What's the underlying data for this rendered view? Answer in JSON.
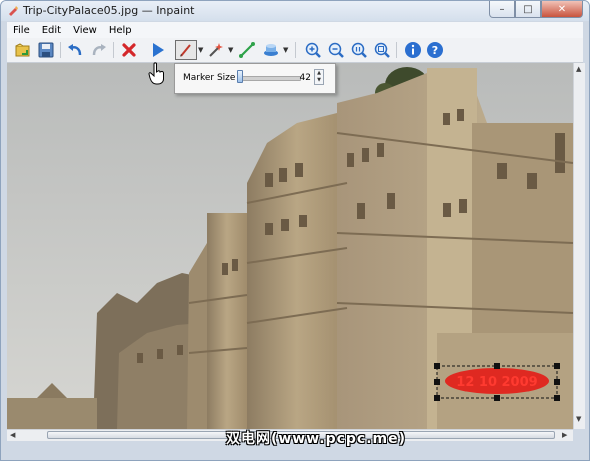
{
  "window": {
    "title": "Trip-CityPalace05.jpg — Inpaint"
  },
  "menu": [
    "File",
    "Edit",
    "View",
    "Help"
  ],
  "toolbar": {
    "icons": [
      "open-icon",
      "save-icon",
      "undo-icon",
      "redo-icon",
      "erase-icon",
      "run-icon",
      "marker-icon",
      "magic-wand-icon",
      "line-icon",
      "eraser-stack-icon",
      "zoom-in-icon",
      "zoom-out-icon",
      "zoom-actual-icon",
      "zoom-fit-icon",
      "info-icon",
      "help-icon"
    ]
  },
  "marker_popup": {
    "label": "Marker Size",
    "value": "42",
    "level_fraction": 0.05
  },
  "image": {
    "stamp_text": "12  10  2009"
  },
  "watermark": "双电网(www.pcpc.me)"
}
